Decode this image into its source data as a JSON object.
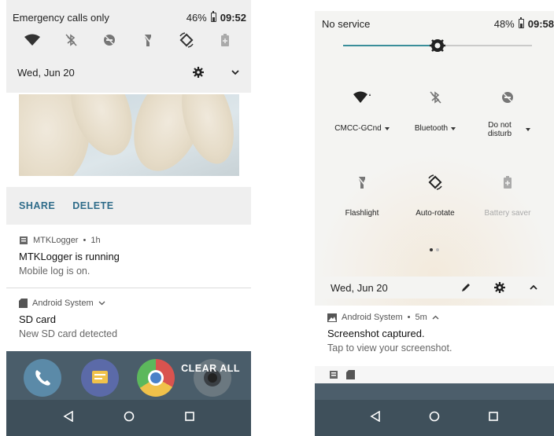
{
  "left_phone": {
    "status": {
      "carrier": "Emergency calls only",
      "battery": "46%",
      "time": "09:52"
    },
    "quick_icons": [
      "wifi-icon",
      "bluetooth-off-icon",
      "dnd-off-icon",
      "flashlight-off-icon",
      "auto-rotate-icon",
      "battery-saver-icon"
    ],
    "date": "Wed, Jun 20",
    "screenshot_actions": {
      "share": "SHARE",
      "delete": "DELETE"
    },
    "notifications": [
      {
        "app": "MTKLogger",
        "time": "1h",
        "title": "MTKLogger is running",
        "body": "Mobile log is on."
      },
      {
        "app": "Android System",
        "title": "SD card",
        "body": "New SD card detected"
      }
    ],
    "clear_all": "CLEAR ALL"
  },
  "right_phone": {
    "status": {
      "carrier": "No service",
      "battery": "48%",
      "time": "09:58"
    },
    "brightness": 0.5,
    "tiles": [
      {
        "label": "CMCC-GCnd",
        "icon": "wifi-icon",
        "dropdown": true,
        "dim": false
      },
      {
        "label": "Bluetooth",
        "icon": "bluetooth-off-icon",
        "dropdown": true,
        "dim": false
      },
      {
        "label": "Do not disturb",
        "icon": "dnd-off-icon",
        "dropdown": true,
        "dim": false
      },
      {
        "label": "Flashlight",
        "icon": "flashlight-off-icon",
        "dropdown": false,
        "dim": false
      },
      {
        "label": "Auto-rotate",
        "icon": "auto-rotate-icon",
        "dropdown": false,
        "dim": false
      },
      {
        "label": "Battery saver",
        "icon": "battery-saver-icon",
        "dropdown": false,
        "dim": true
      }
    ],
    "date": "Wed, Jun 20",
    "notification": {
      "app": "Android System",
      "time": "5m",
      "title": "Screenshot captured.",
      "body": "Tap to view your screenshot."
    }
  },
  "colors": {
    "accent": "#2f6c8a",
    "panel": "#efefef",
    "homescreen": "#4a5d6a",
    "brightness": "#3a8e9a"
  }
}
